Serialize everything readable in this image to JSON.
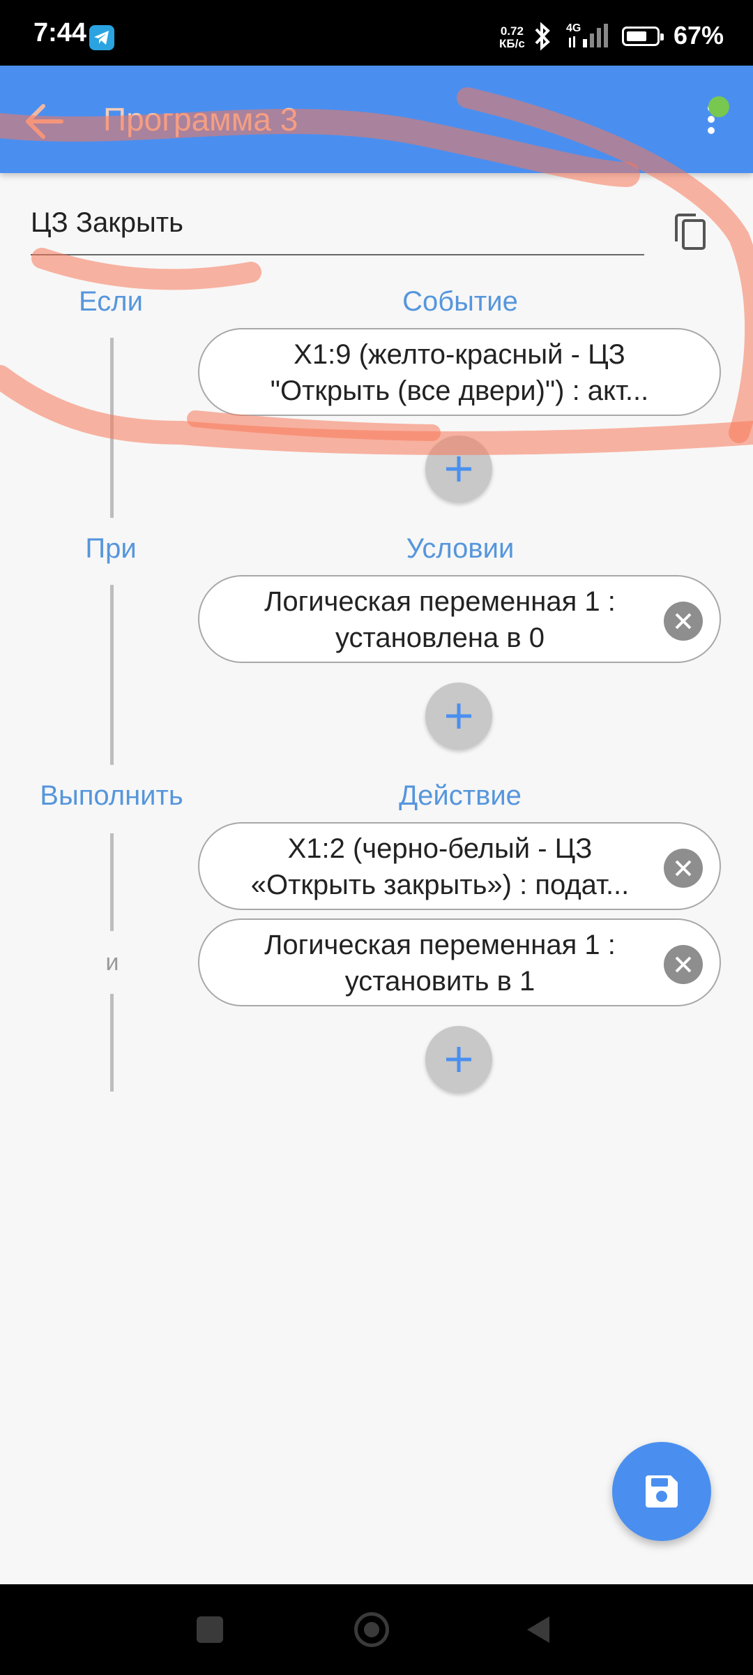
{
  "status_bar": {
    "time": "7:44",
    "net_speed_value": "0.72",
    "net_speed_unit": "КБ/с",
    "network": "4G",
    "battery_level": 0.67,
    "battery": "67%",
    "icons": [
      "telegram-icon",
      "bluetooth-icon",
      "signal-icon",
      "battery-icon"
    ]
  },
  "app_bar": {
    "title": "Программа 3",
    "back_icon": "arrow-left-icon",
    "menu_icon": "more-vert-icon",
    "accent": "#4a8ff0",
    "status_dot_color": "#78c850"
  },
  "program": {
    "name_value": "ЦЗ Закрыть",
    "copy_icon": "copy-icon"
  },
  "sections": {
    "if_label": "Если",
    "event_header": "Событие",
    "when_label": "При",
    "condition_header": "Условии",
    "do_label": "Выполнить",
    "action_header": "Действие",
    "and_label": "и"
  },
  "events": [
    {
      "line1": "X1:9 (желто-красный - ЦЗ",
      "line2": "\"Открыть (все двери)\") : акт..."
    }
  ],
  "conditions": [
    {
      "line1": "Логическая переменная 1 :",
      "line2": "установлена в 0"
    }
  ],
  "actions": [
    {
      "line1": "X1:2 (черно-белый - ЦЗ",
      "line2": "«Открыть закрыть») : подат..."
    },
    {
      "line1": "Логическая переменная 1 :",
      "line2": "установить в 1"
    }
  ],
  "fab": {
    "icon": "save-icon"
  },
  "nav_bar": {
    "icons": [
      "recents-icon",
      "home-icon",
      "back-icon"
    ]
  }
}
